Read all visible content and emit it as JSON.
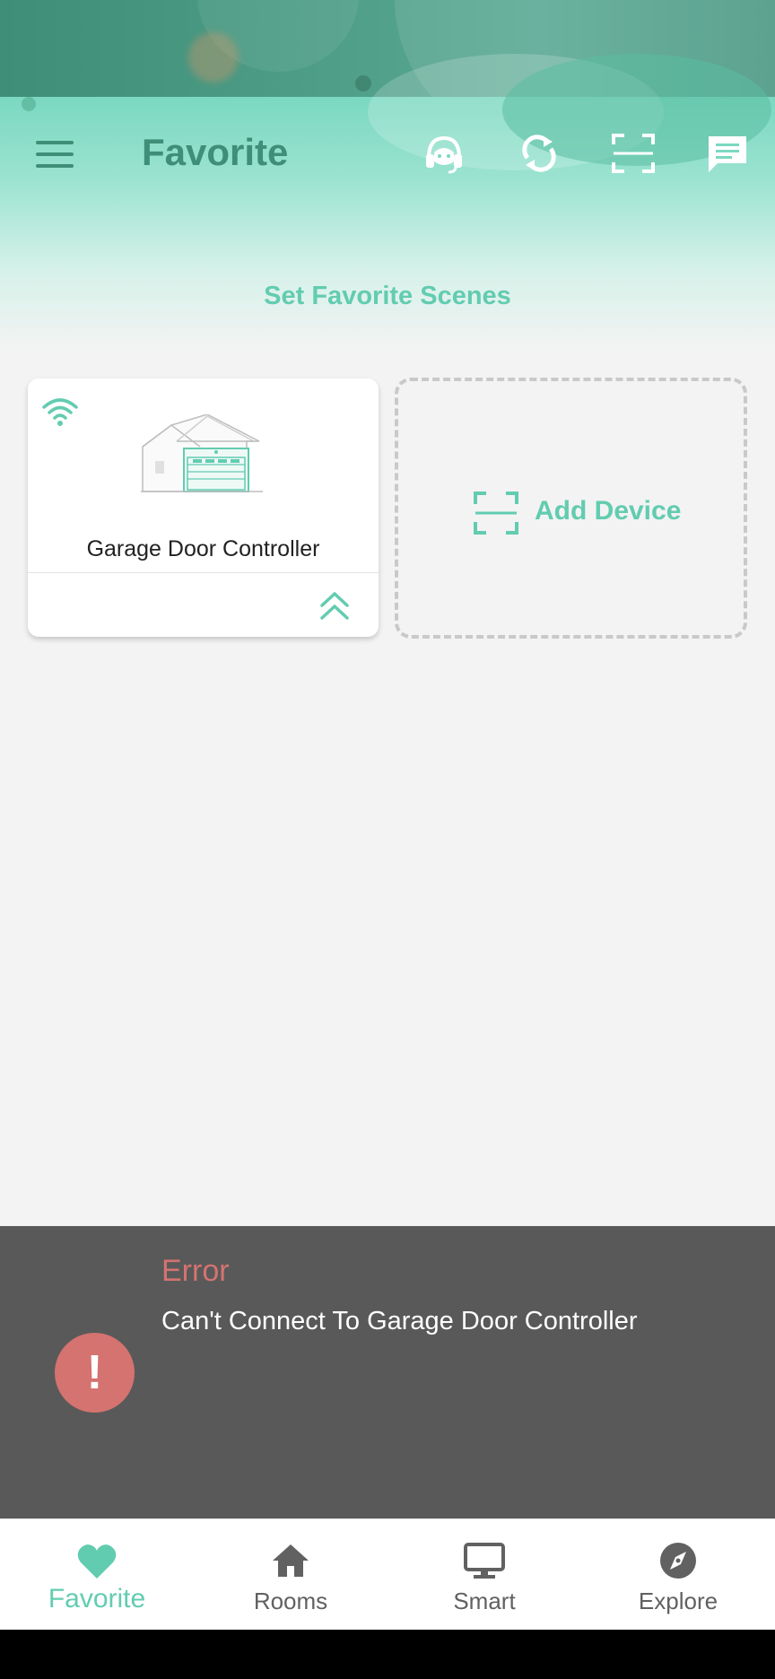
{
  "header": {
    "title": "Favorite",
    "icons": [
      "menu-icon",
      "headset-icon",
      "refresh-icon",
      "scan-icon",
      "message-icon"
    ],
    "scenes_link": "Set Favorite Scenes"
  },
  "devices": [
    {
      "name": "Garage Door Controller",
      "connection": "wifi-icon",
      "image": "garage-icon"
    }
  ],
  "add_device": {
    "label": "Add Device",
    "icon": "scan-icon"
  },
  "error": {
    "title": "Error",
    "message": "Can't Connect To Garage Door Controller",
    "icon_glyph": "!"
  },
  "nav": {
    "items": [
      {
        "label": "Favorite",
        "icon": "heart-icon",
        "active": true
      },
      {
        "label": "Rooms",
        "icon": "home-icon",
        "active": false
      },
      {
        "label": "Smart",
        "icon": "monitor-icon",
        "active": false
      },
      {
        "label": "Explore",
        "icon": "compass-icon",
        "active": false
      }
    ]
  },
  "colors": {
    "accent": "#62ccb0",
    "header_dark": "#3f8e77",
    "error": "#d47370",
    "error_panel": "#595959"
  }
}
